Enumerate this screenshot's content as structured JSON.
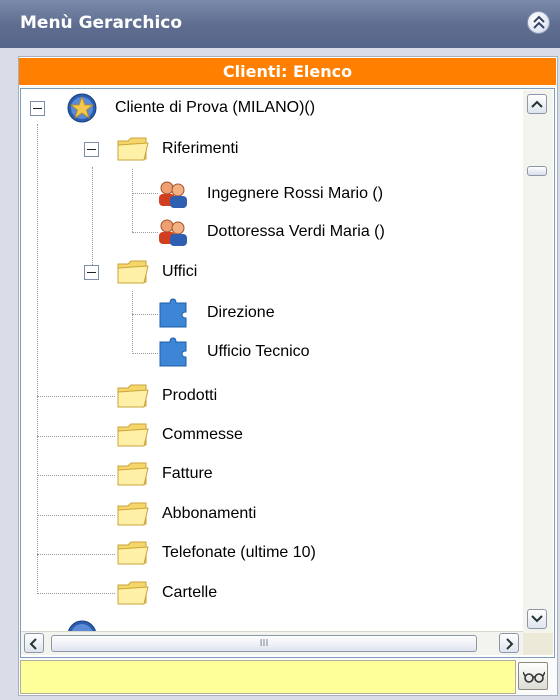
{
  "panel": {
    "title": "Menù Gerarchico"
  },
  "header_bar": {
    "label": "Clienti: Elenco"
  },
  "tree": {
    "root": "Cliente di Prova (MILANO)()",
    "riferimenti": "Riferimenti",
    "ref1": "Ingegnere Rossi Mario ()",
    "ref2": "Dottoressa Verdi Maria ()",
    "uffici": "Uffici",
    "uff1": "Direzione",
    "uff2": "Ufficio Tecnico",
    "prodotti": "Prodotti",
    "commesse": "Commesse",
    "fatture": "Fatture",
    "abbonamenti": "Abbonamenti",
    "telefonate": "Telefonate (ultime 10)",
    "cartelle": "Cartelle"
  },
  "hscroll": {
    "grip": "III"
  },
  "search": {
    "value": ""
  },
  "colors": {
    "orange": "#ff7f00",
    "input_bg": "#ffff99",
    "title_bg": "#5e6d8f"
  }
}
